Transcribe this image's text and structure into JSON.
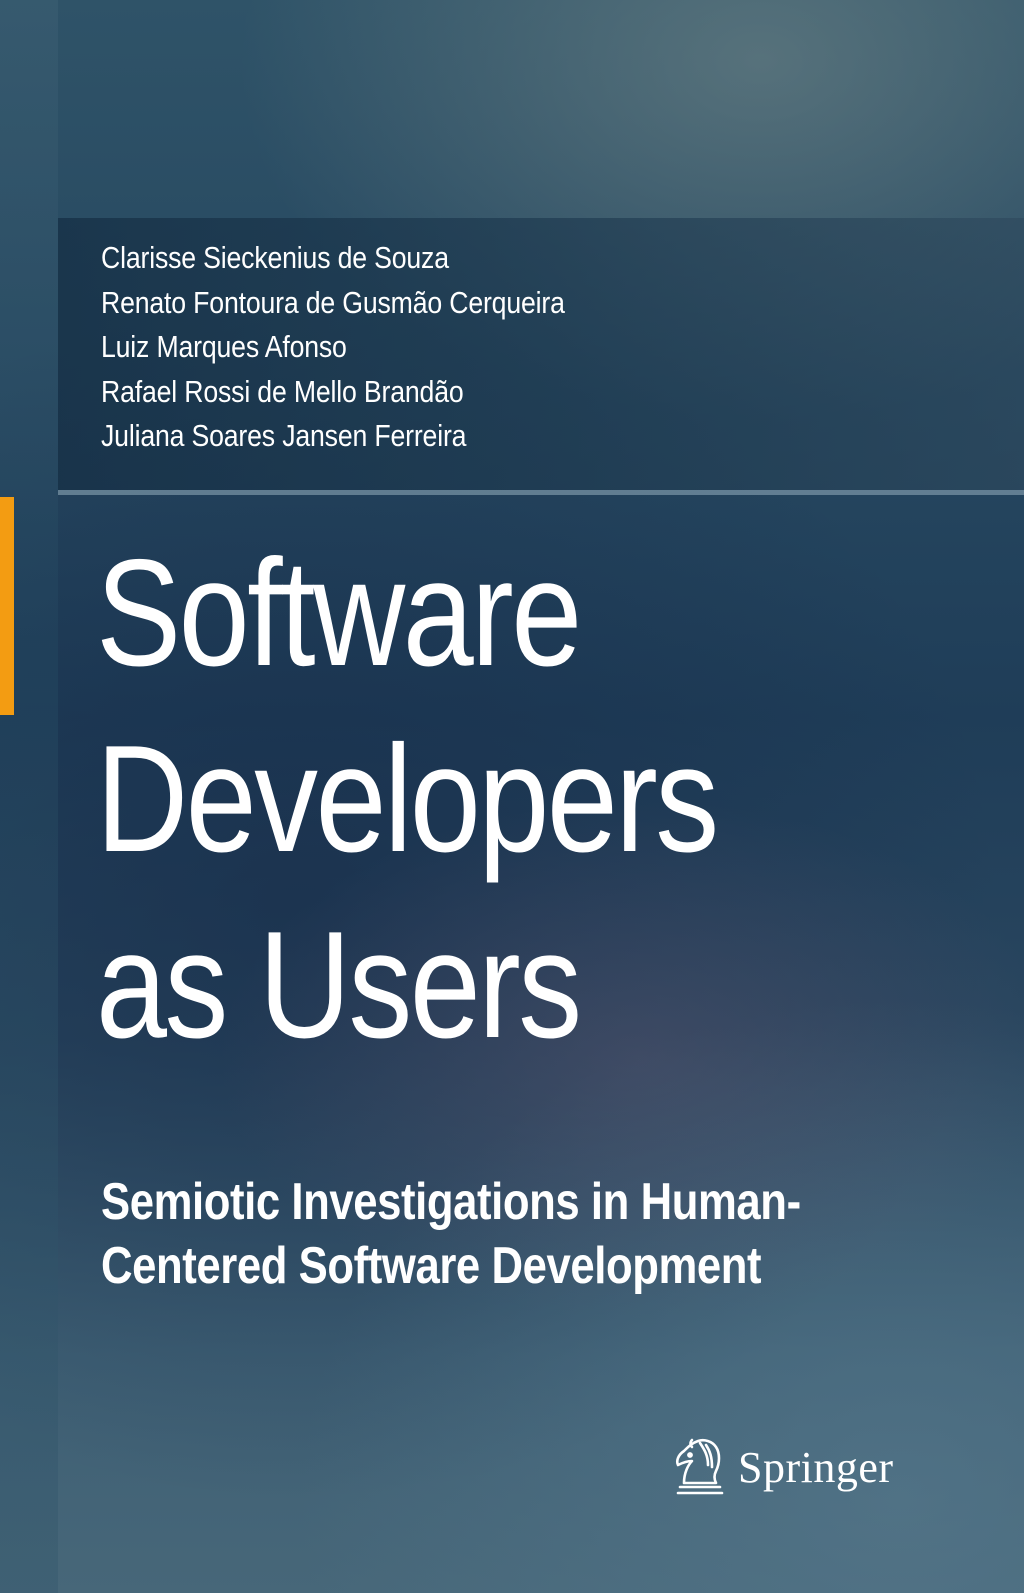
{
  "cover": {
    "authors": [
      "Clarisse Sieckenius de Souza",
      "Renato Fontoura de Gusmão Cerqueira",
      "Luiz Marques Afonso",
      "Rafael Rossi de Mello Brandão",
      "Juliana Soares Jansen Ferreira"
    ],
    "title_lines": [
      "Software",
      "Developers",
      "as Users"
    ],
    "subtitle_lines": [
      "Semiotic Investigations in Human-",
      "Centered Software Development"
    ],
    "publisher": "Springer",
    "publisher_icon": "chess-knight-horse-icon",
    "colors": {
      "accent": "#f39c12",
      "background": "#284a62",
      "text": "#ffffff"
    }
  }
}
